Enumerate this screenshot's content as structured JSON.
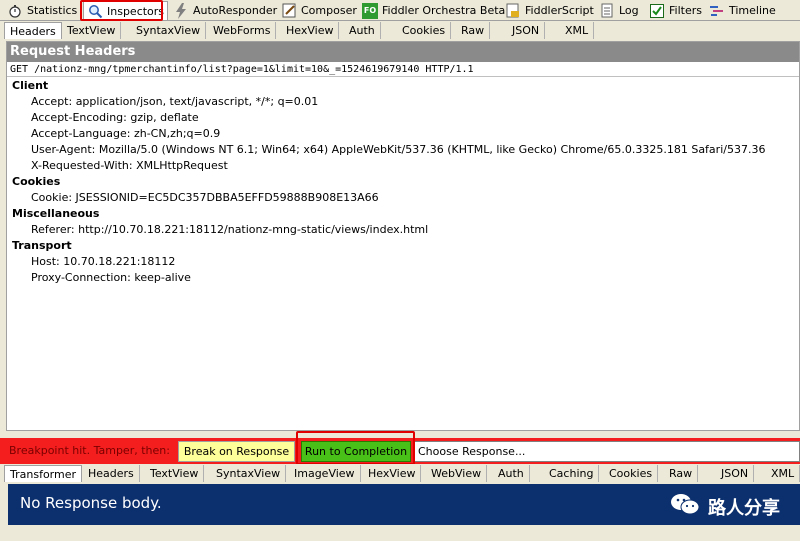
{
  "top_tabs": [
    {
      "label": "Statistics",
      "icon": "stopwatch-icon"
    },
    {
      "label": "Inspectors",
      "icon": "magnifier-icon"
    },
    {
      "label": "AutoResponder",
      "icon": "lightning-icon"
    },
    {
      "label": "Composer",
      "icon": "pencil-icon"
    },
    {
      "label": "Fiddler Orchestra Beta",
      "icon": "fo-icon",
      "icon_text": "FO"
    },
    {
      "label": "FiddlerScript",
      "icon": "script-icon"
    },
    {
      "label": "Log",
      "icon": "log-icon"
    },
    {
      "label": "Filters",
      "icon": "checkbox-icon"
    },
    {
      "label": "Timeline",
      "icon": "timeline-icon"
    }
  ],
  "request_tabs": [
    "Headers",
    "TextView",
    "SyntaxView",
    "WebForms",
    "HexView",
    "Auth",
    "Cookies",
    "Raw",
    "JSON",
    "XML"
  ],
  "request": {
    "title": "Request Headers",
    "request_line": "GET /nationz-mng/tpmerchantinfo/list?page=1&limit=10&_=1524619679140 HTTP/1.1",
    "groups": [
      {
        "name": "Client",
        "headers": [
          "Accept: application/json, text/javascript, */*; q=0.01",
          "Accept-Encoding: gzip, deflate",
          "Accept-Language: zh-CN,zh;q=0.9",
          "User-Agent: Mozilla/5.0 (Windows NT 6.1; Win64; x64) AppleWebKit/537.36 (KHTML, like Gecko) Chrome/65.0.3325.181 Safari/537.36",
          "X-Requested-With: XMLHttpRequest"
        ]
      },
      {
        "name": "Cookies",
        "headers": [
          "Cookie: JSESSIONID=EC5DC357DBBA5EFFD59888B908E13A66"
        ]
      },
      {
        "name": "Miscellaneous",
        "headers": [
          "Referer: http://10.70.18.221:18112/nationz-mng-static/views/index.html"
        ]
      },
      {
        "name": "Transport",
        "headers": [
          "Host: 10.70.18.221:18112",
          "Proxy-Connection: keep-alive"
        ]
      }
    ]
  },
  "breakpoint": {
    "label": "Breakpoint hit. Tamper, then:",
    "break_button": "Break on Response",
    "run_button": "Run to Completion",
    "choose_response": "Choose Response..."
  },
  "response_tabs": [
    "Transformer",
    "Headers",
    "TextView",
    "SyntaxView",
    "ImageView",
    "HexView",
    "WebView",
    "Auth",
    "Caching",
    "Cookies",
    "Raw",
    "JSON",
    "XML"
  ],
  "response": {
    "body_text": "No Response body."
  },
  "watermark": {
    "text": "路人分享",
    "icon": "wechat-icon"
  },
  "colors": {
    "breakpoint_bar": "#f41e1e",
    "run_button": "#48c018",
    "break_button": "#ffff99",
    "response_bg": "#0c2f6e",
    "highlight_box": "#e00000"
  }
}
